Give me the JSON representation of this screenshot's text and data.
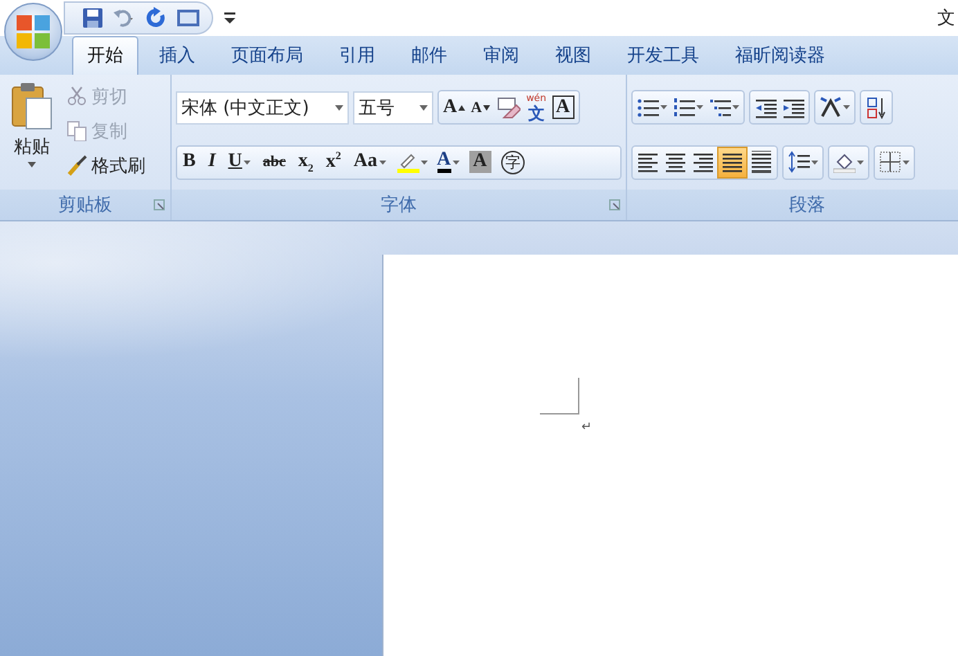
{
  "window": {
    "title": "文"
  },
  "tabs": [
    {
      "label": "开始",
      "selected": true
    },
    {
      "label": "插入",
      "selected": false
    },
    {
      "label": "页面布局",
      "selected": false
    },
    {
      "label": "引用",
      "selected": false
    },
    {
      "label": "邮件",
      "selected": false
    },
    {
      "label": "审阅",
      "selected": false
    },
    {
      "label": "视图",
      "selected": false
    },
    {
      "label": "开发工具",
      "selected": false
    },
    {
      "label": "福昕阅读器",
      "selected": false
    }
  ],
  "clipboard": {
    "paste": "粘贴",
    "group_label": "剪贴板",
    "items": [
      {
        "kind": "cut",
        "label": "剪切",
        "disabled": true
      },
      {
        "kind": "copy",
        "label": "复制",
        "disabled": true
      },
      {
        "kind": "painter",
        "label": "格式刷",
        "disabled": false
      }
    ]
  },
  "font": {
    "group_label": "字体",
    "font_name": "宋体 (中文正文)",
    "font_size": "五号",
    "row1": [
      {
        "kind": "grow",
        "glyph": "A"
      },
      {
        "kind": "shrink",
        "glyph": "A"
      },
      {
        "kind": "clear"
      },
      {
        "kind": "phonetic",
        "glyph": "文",
        "ruby": "wén"
      },
      {
        "kind": "border",
        "glyph": "A"
      }
    ],
    "row2": [
      {
        "kind": "bold",
        "glyph": "B"
      },
      {
        "kind": "italic",
        "glyph": "I"
      },
      {
        "kind": "underline",
        "glyph": "U",
        "dropdown": true
      },
      {
        "kind": "strike",
        "glyph": "abc"
      },
      {
        "kind": "sub",
        "glyph": "x",
        "index": "2"
      },
      {
        "kind": "sup",
        "glyph": "x",
        "index": "2"
      },
      {
        "kind": "case",
        "glyph": "Aa",
        "dropdown": true
      },
      {
        "kind": "highlight",
        "dropdown": true
      },
      {
        "kind": "color",
        "glyph": "A",
        "dropdown": true
      },
      {
        "kind": "shade",
        "glyph": "A"
      },
      {
        "kind": "enclose",
        "glyph": "字"
      }
    ]
  },
  "paragraph": {
    "group_label": "段落",
    "row1": [
      {
        "kind": "bullets",
        "dropdown": true
      },
      {
        "kind": "numbering",
        "dropdown": true
      },
      {
        "kind": "multilevel",
        "dropdown": true
      },
      {
        "kind": "outdent"
      },
      {
        "kind": "indent"
      },
      {
        "kind": "layout",
        "dropdown": true
      },
      {
        "kind": "sort"
      }
    ],
    "alignment": [
      {
        "kind": "left",
        "selected": false
      },
      {
        "kind": "center",
        "selected": false
      },
      {
        "kind": "right",
        "selected": false
      },
      {
        "kind": "justify",
        "selected": true
      },
      {
        "kind": "distributed",
        "selected": false
      }
    ],
    "row2": [
      {
        "kind": "spacing",
        "dropdown": true
      },
      {
        "kind": "fill",
        "dropdown": true
      },
      {
        "kind": "borders",
        "dropdown": true
      }
    ]
  },
  "document": {
    "paragraph_mark": "↵"
  }
}
